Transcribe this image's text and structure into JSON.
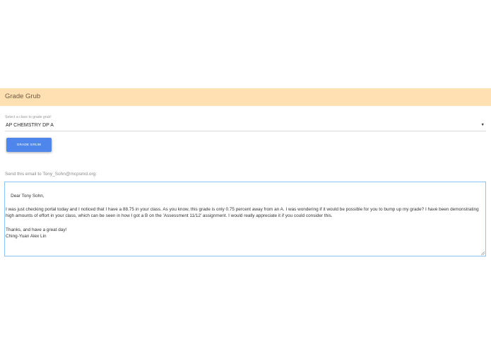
{
  "header": {
    "title": "Grade Grub",
    "background_color": "#ffe0b2"
  },
  "class_select": {
    "label": "Select a class to grade grub!",
    "selected_value": "AP CHEMSTRY DP A",
    "caret": "▼"
  },
  "grub_button": {
    "label": "GRADE GRUB!",
    "color": "#4f86ec"
  },
  "email": {
    "send_label": "Send this email to Tony_Sohn@mcpsmd.org:",
    "body": "Dear Tony Sohn,\n\nI was just checking portal today and I noticed that I have a 88.75 in your class. As you know, this grade is only 0.75 percent away from an A. I was wondering if it would be possible for you to bump up my grade? I have been demonstrating high amounts of effort in your class, which can be seen in how I got a B on the 'Assessment 11/12' assignment. I would really appreciate it if you could consider this.\n\nThanks, and have a great day!\nChing-Yuan Alex Lin",
    "border_color": "#8ec3ef"
  }
}
